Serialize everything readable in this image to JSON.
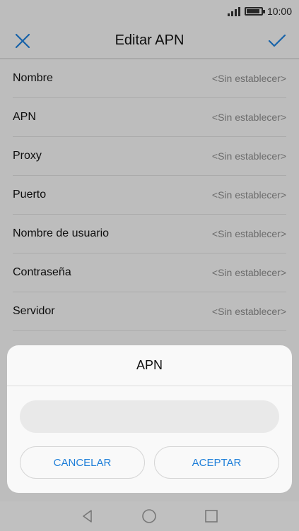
{
  "status_bar": {
    "time": "10:00",
    "signal_icon": "signal-icon",
    "battery_icon": "battery-icon",
    "battery_level": 0.9
  },
  "app_bar": {
    "title": "Editar APN",
    "close_icon": "close-icon",
    "confirm_icon": "check-icon"
  },
  "fields": [
    {
      "label": "Nombre",
      "value": "<Sin establecer>"
    },
    {
      "label": "APN",
      "value": "<Sin establecer>"
    },
    {
      "label": "Proxy",
      "value": "<Sin establecer>"
    },
    {
      "label": "Puerto",
      "value": "<Sin establecer>"
    },
    {
      "label": "Nombre de usuario",
      "value": "<Sin establecer>"
    },
    {
      "label": "Contraseña",
      "value": "<Sin establecer>"
    },
    {
      "label": "Servidor",
      "value": "<Sin establecer>"
    }
  ],
  "dialog": {
    "title": "APN",
    "input_value": "",
    "cancel_label": "CANCELAR",
    "ok_label": "ACEPTAR"
  },
  "nav": {
    "back_icon": "back-triangle-icon",
    "home_icon": "home-circle-icon",
    "recents_icon": "recents-square-icon"
  },
  "colors": {
    "accent": "#1f7fd9",
    "background": "#f3f3f3",
    "dialog_bg": "#f9f9f9"
  }
}
